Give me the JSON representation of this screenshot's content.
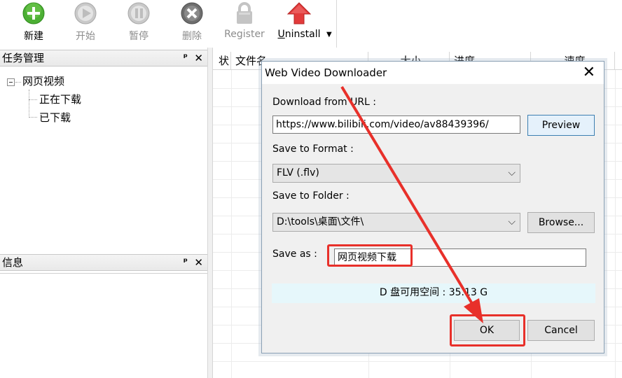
{
  "toolbar": {
    "buttons": [
      {
        "label": "新建",
        "icon": "plus-circle-icon",
        "color": "#4caf34"
      },
      {
        "label": "开始",
        "icon": "play-circle-icon",
        "color": "#b8b8b8"
      },
      {
        "label": "暂停",
        "icon": "pause-circle-icon",
        "color": "#b8b8b8"
      },
      {
        "label": "删除",
        "icon": "close-circle-icon",
        "color": "#6e6e6e"
      },
      {
        "label": "Register",
        "icon": "lock-icon",
        "color": "#c4c4c4"
      },
      {
        "label": "Uninstall",
        "icon": "up-arrow-icon",
        "color": "#e23b3b"
      }
    ],
    "dropdown_glyph": "▼"
  },
  "tasks_pane": {
    "title": "任务管理",
    "pin_glyph": "ᵖ",
    "close_glyph": "✕",
    "tree": {
      "root": "网页视频",
      "children": [
        "正在下载",
        "已下载"
      ]
    }
  },
  "info_pane": {
    "title": "信息",
    "pin_glyph": "ᵖ",
    "close_glyph": "✕"
  },
  "grid": {
    "columns": [
      "状",
      "文件名",
      "大小",
      "进度",
      "速度"
    ]
  },
  "dialog": {
    "title": "Web Video Downloader",
    "close_glyph": "✕",
    "url_label": "Download from URL :",
    "url_value": "https://www.bilibili.com/video/av88439396/",
    "preview_label": "Preview",
    "format_label": "Save to Format :",
    "format_value": "FLV (.flv)",
    "folder_label": "Save to Folder :",
    "folder_value": "D:\\tools\\桌面\\文件\\",
    "browse_label": "Browse...",
    "save_as_label": "Save as :",
    "save_as_value": "网页视频下载",
    "free_space_text": "D 盘可用空间 : 35.13 G",
    "ok_label": "OK",
    "cancel_label": "Cancel"
  },
  "colors": {
    "annotation": "#e8302a",
    "ok_border": "#3c7fb1"
  }
}
